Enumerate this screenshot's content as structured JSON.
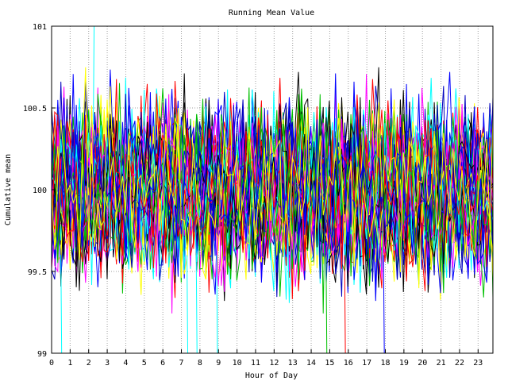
{
  "chart_data": {
    "type": "line",
    "title": "Running Mean Value",
    "xlabel": "Hour of Day",
    "ylabel": "Cumulative mean",
    "xlim": [
      0,
      23.8
    ],
    "ylim": [
      99,
      101
    ],
    "x_ticks": [
      0,
      1,
      2,
      3,
      4,
      5,
      6,
      7,
      8,
      9,
      10,
      11,
      12,
      13,
      14,
      15,
      16,
      17,
      18,
      19,
      20,
      21,
      22,
      23
    ],
    "x_tick_labels": [
      "0",
      "1",
      "2",
      "3",
      "4",
      "5",
      "6",
      "7",
      "8",
      "9",
      "10",
      "11",
      "12",
      "13",
      "14",
      "15",
      "16",
      "17",
      "18",
      "19",
      "20",
      "21",
      "22",
      "23"
    ],
    "y_ticks": [
      99,
      99.5,
      100,
      100.5,
      101
    ],
    "y_tick_labels": [
      "99",
      "99.5",
      "100",
      "100.5",
      "101"
    ],
    "grid": true,
    "legend": "none",
    "series_colors": [
      "#ff0000",
      "#00c000",
      "#0000ff",
      "#ffff00",
      "#00ffff",
      "#ff00ff",
      "#000000",
      "#0000c0"
    ],
    "series_count": 60,
    "points_per_series": 144,
    "central_value": 100,
    "typical_spread": 0.25,
    "spikes": [
      {
        "x": 2.25,
        "y": 101.0,
        "color": "#00ffff"
      },
      {
        "x": 0.5,
        "y": 99.0,
        "color": "#00ffff"
      },
      {
        "x": 7.3,
        "y": 99.0,
        "color": "#00ffff"
      },
      {
        "x": 7.8,
        "y": 99.0,
        "color": "#00ffff"
      },
      {
        "x": 8.9,
        "y": 99.0,
        "color": "#00ffff"
      },
      {
        "x": 14.8,
        "y": 99.0,
        "color": "#00c000"
      },
      {
        "x": 15.8,
        "y": 99.0,
        "color": "#ff0000"
      },
      {
        "x": 17.9,
        "y": 99.0,
        "color": "#0000ff"
      }
    ]
  }
}
